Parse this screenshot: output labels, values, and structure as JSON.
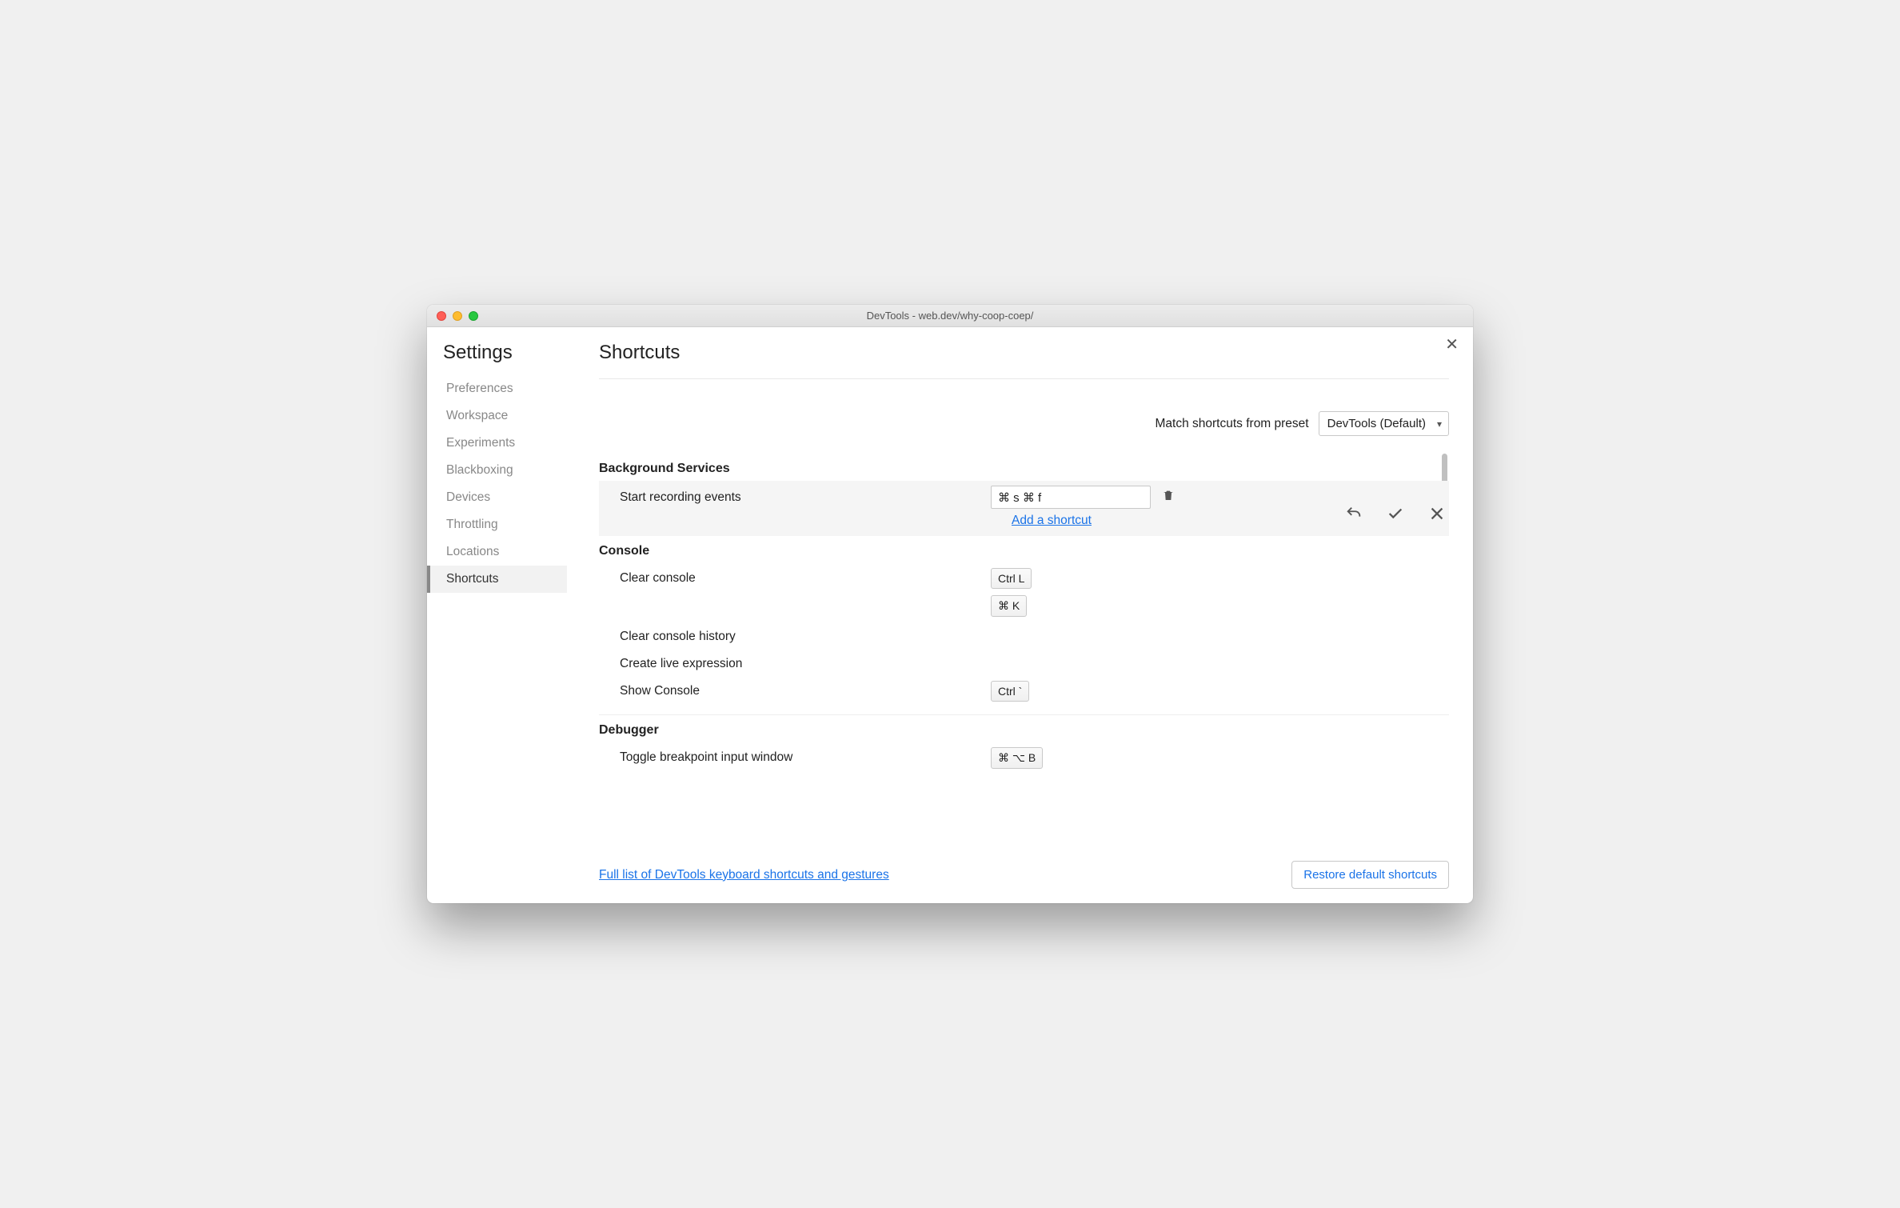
{
  "window": {
    "title": "DevTools - web.dev/why-coop-coep/"
  },
  "sidebar": {
    "heading": "Settings",
    "items": [
      "Preferences",
      "Workspace",
      "Experiments",
      "Blackboxing",
      "Devices",
      "Throttling",
      "Locations",
      "Shortcuts"
    ],
    "activeIndex": 7
  },
  "page": {
    "title": "Shortcuts",
    "presetLabel": "Match shortcuts from preset",
    "presetValue": "DevTools (Default)",
    "fullListLink": "Full list of DevTools keyboard shortcuts and gestures",
    "restoreButton": "Restore default shortcuts",
    "addShortcut": "Add a shortcut"
  },
  "sections": {
    "bg": {
      "title": "Background Services",
      "startRecording": {
        "label": "Start recording events",
        "inputValue": "⌘ s ⌘ f"
      }
    },
    "console": {
      "title": "Console",
      "clear": {
        "label": "Clear console",
        "keys": [
          "Ctrl L",
          "⌘ K"
        ]
      },
      "clearHistory": {
        "label": "Clear console history"
      },
      "liveExpr": {
        "label": "Create live expression"
      },
      "show": {
        "label": "Show Console",
        "keys": [
          "Ctrl `"
        ]
      }
    },
    "debugger": {
      "title": "Debugger",
      "toggleBp": {
        "label": "Toggle breakpoint input window",
        "keys": [
          "⌘ ⌥ B"
        ]
      }
    }
  }
}
